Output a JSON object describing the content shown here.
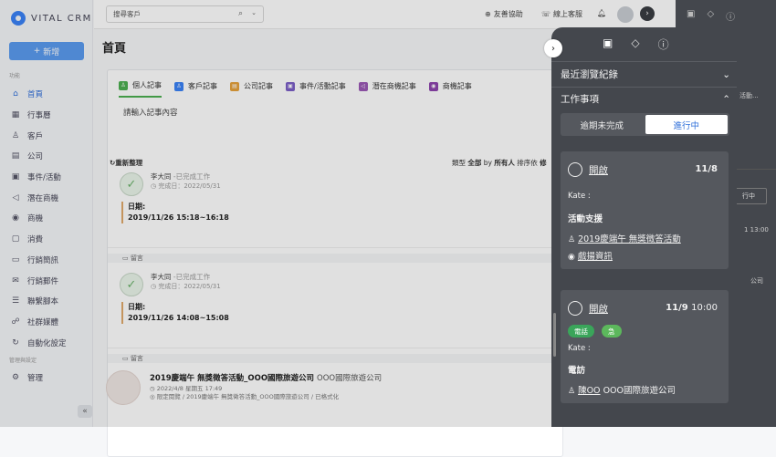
{
  "app": {
    "brand": "VITAL CRM"
  },
  "sidebar": {
    "add_label": "新增",
    "section_function": "功能",
    "section_mgmt": "管理與設定",
    "items": [
      {
        "label": "首頁",
        "icon": "home-icon",
        "glyph": "⌂"
      },
      {
        "label": "行事曆",
        "icon": "calendar-icon",
        "glyph": "▦"
      },
      {
        "label": "客戶",
        "icon": "user-icon",
        "glyph": "♙"
      },
      {
        "label": "公司",
        "icon": "building-icon",
        "glyph": "▤"
      },
      {
        "label": "事件/活動",
        "icon": "event-icon",
        "glyph": "▣"
      },
      {
        "label": "潛在商機",
        "icon": "megaphone-icon",
        "glyph": "◁"
      },
      {
        "label": "商機",
        "icon": "pin-icon",
        "glyph": "◉"
      },
      {
        "label": "消費",
        "icon": "receipt-icon",
        "glyph": "▢"
      },
      {
        "label": "行銷簡訊",
        "icon": "sms-icon",
        "glyph": "▭"
      },
      {
        "label": "行銷郵件",
        "icon": "mail-icon",
        "glyph": "✉"
      },
      {
        "label": "聯繫腳本",
        "icon": "script-icon",
        "glyph": "☰"
      },
      {
        "label": "社群媒體",
        "icon": "social-icon",
        "glyph": "☍"
      },
      {
        "label": "自動化設定",
        "icon": "automation-icon",
        "glyph": "↻"
      }
    ],
    "mgmt_item": {
      "label": "管理",
      "icon": "gear-icon",
      "glyph": "⚙"
    }
  },
  "topbar": {
    "search_placeholder": "搜尋客戶",
    "friend_help": "友善協助",
    "online_service": "線上客服"
  },
  "main": {
    "page_title": "首頁",
    "tabs": [
      {
        "label": "個人記事",
        "color": "#4caf50",
        "glyph": "♙"
      },
      {
        "label": "客戶記事",
        "color": "#3b82f6",
        "glyph": "♙"
      },
      {
        "label": "公司記事",
        "color": "#e6a23c",
        "glyph": "▤"
      },
      {
        "label": "事件/活動記事",
        "color": "#7b5fc7",
        "glyph": "▣"
      },
      {
        "label": "潛在商機記事",
        "color": "#9b59b6",
        "glyph": "◁"
      },
      {
        "label": "商機記事",
        "color": "#8e44ad",
        "glyph": "◉"
      }
    ],
    "note_placeholder": "請輸入記事內容",
    "refresh": "重新整理",
    "filter_type": "類型",
    "filter_type_val": "全部",
    "filter_by": "by",
    "filter_by_val": "所有人",
    "filter_sort": "排序依",
    "filter_sort_val": "修",
    "records": [
      {
        "who": "李大同",
        "status": "-已完成工作",
        "done": "完成日：2022/05/31",
        "date_label": "日期:",
        "date_range": "2019/11/26 15:18~16:18",
        "side": [
          "李大",
          "李大"
        ],
        "comment": "留言"
      },
      {
        "who": "李大同",
        "status": "-已完成工作",
        "done": "完成日：2022/05/31",
        "date_label": "日期:",
        "date_range": "2019/11/26 14:08~15:08",
        "side": [
          "李大",
          "李大"
        ],
        "comment": "留言"
      }
    ],
    "event": {
      "title": "2019慶端午 無獎徵答活動_OOO國際旅遊公司",
      "company": "OOO國際旅遊公司",
      "meta1": "2022/4/8 星期五 17:49",
      "meta2": "限定閱覽 / 2019慶端午 無獎徵答活動_OOO國際旅遊公司 / 已格式化"
    }
  },
  "right_dark": {
    "text1": "活動...",
    "btn": "行中",
    "time": "1 13:00",
    "company": "公司"
  },
  "panel": {
    "recent_label": "最近瀏覽紀錄",
    "todo_label": "工作事項",
    "seg_overdue": "逾期未完成",
    "seg_inprogress": "進行中",
    "tasks": [
      {
        "open": "開啟",
        "date": "11/8",
        "time": "",
        "person": "Kate :",
        "type": "活動支援",
        "link1": "2019慶端午 無獎徵答活動",
        "link2": "戲揚資訊"
      },
      {
        "open": "開啟",
        "date": "11/9",
        "time": "10:00",
        "badges": [
          {
            "label": "電話",
            "color": "#3aa55a"
          },
          {
            "label": "急",
            "color": "#5cb85c"
          }
        ],
        "person": "Kate :",
        "type": "電訪",
        "link1": "陳OO",
        "link1_extra": "OOO國際旅遊公司"
      }
    ]
  }
}
